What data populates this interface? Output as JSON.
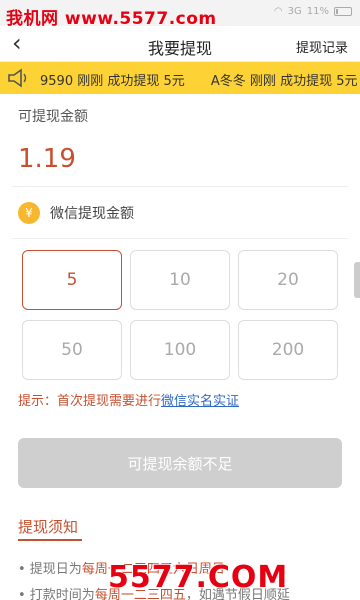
{
  "statusbar": {
    "watermark": "我机网 www.5577.com",
    "network": "3G",
    "battery": "11%",
    "wifi_icon": "wifi-icon"
  },
  "nav": {
    "title": "我要提现",
    "right_link": "提现记录"
  },
  "ticker": {
    "items": [
      "9590 刚刚 成功提现 5元",
      "A冬冬 刚刚 成功提现 5元"
    ]
  },
  "balance": {
    "label": "可提现金额",
    "amount": "1.19"
  },
  "wechat": {
    "label": "微信提现金额"
  },
  "options": [
    "5",
    "10",
    "20",
    "50",
    "100",
    "200"
  ],
  "selected_option": "5",
  "tip": {
    "prefix": "提示：首次提现需要进行",
    "link": "微信实名实证"
  },
  "submit_button": "可提现余额不足",
  "notes": {
    "title": "提现须知",
    "lines": [
      {
        "text": "• 提现日为",
        "highlight": "每周一二三四五六日周日"
      },
      {
        "text": "• 打款时间为",
        "highlight": "每周一二三四五",
        "tail": "，如遇节假日顺延"
      }
    ]
  },
  "watermark_bottom": "5577.COM",
  "colors": {
    "accent": "#c8502e",
    "ticker_bg": "#fdd235",
    "link": "#2e69c8",
    "button_disabled": "#cfcfcf"
  }
}
